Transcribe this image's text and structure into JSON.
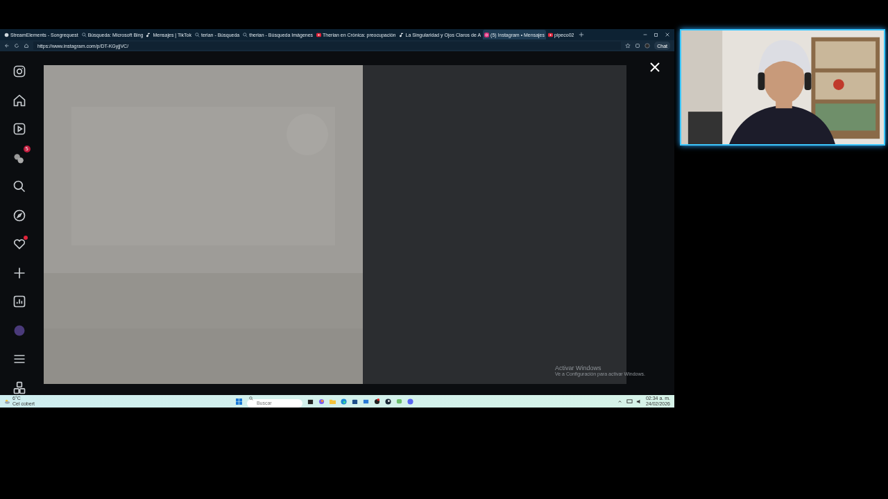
{
  "browser": {
    "tabs": [
      {
        "title": "StreamElements - Songrequest",
        "selected": false
      },
      {
        "title": "Búsqueda: Microsoft Bing",
        "selected": false
      },
      {
        "title": "Mensajes | TikTok",
        "selected": false
      },
      {
        "title": "terian - Búsqueda",
        "selected": false
      },
      {
        "title": "therian - Búsqueda Imágenes",
        "selected": false
      },
      {
        "title": "Therian en Crónica: preocupación",
        "selected": false
      },
      {
        "title": "La Singularidad y Ojos Claros de A",
        "selected": false
      },
      {
        "title": "(5) Instagram • Mensajes",
        "selected": true
      },
      {
        "title": "pipeco02",
        "selected": false
      }
    ],
    "url": "https://www.instagram.com/p/DT-KGyjjVC/",
    "chat_button": "Chat"
  },
  "instagram": {
    "nav": [
      {
        "kind": "logo"
      },
      {
        "kind": "home"
      },
      {
        "kind": "reels"
      },
      {
        "kind": "messages",
        "badge": "5"
      },
      {
        "kind": "search"
      },
      {
        "kind": "explore"
      },
      {
        "kind": "notifications",
        "alert": true
      },
      {
        "kind": "create"
      },
      {
        "kind": "dashboard"
      },
      {
        "kind": "profile"
      },
      {
        "kind": "menu"
      },
      {
        "kind": "apps"
      }
    ]
  },
  "activation_notice": {
    "title": "Activar Windows",
    "text": "Ve a Configuración para activar Windows."
  },
  "taskbar": {
    "temperature": "6°C",
    "weather": "Cel cobert",
    "search_placeholder": "Buscar",
    "time": "02:34 a. m.",
    "date": "24/02/2026"
  }
}
